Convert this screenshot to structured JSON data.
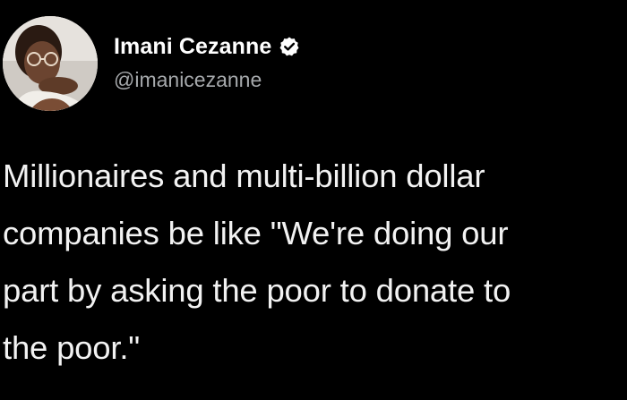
{
  "tweet": {
    "author": {
      "display_name": "Imani Cezanne",
      "handle": "@imanicezanne",
      "verified_icon": "verified-badge-icon",
      "avatar_icon": "avatar"
    },
    "text": "Millionaires and multi-billion dollar\ncompanies be like \"We're doing our\npart by asking the poor to donate to\nthe poor.\""
  },
  "colors": {
    "background": "#000000",
    "text": "#f2f2f2",
    "handle": "#a6a9ac",
    "badge": "#ffffff"
  }
}
